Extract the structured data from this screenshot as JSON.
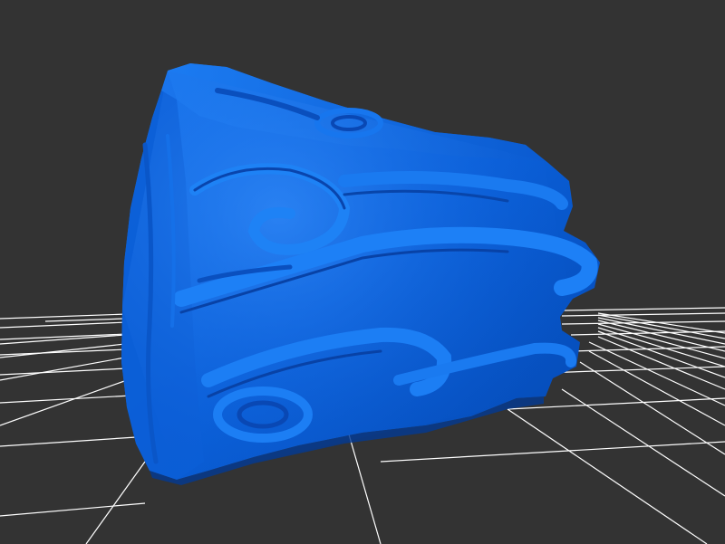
{
  "viewport": {
    "background_color": "#333333"
  },
  "grid": {
    "visible": true,
    "line_color": "#ffffff"
  },
  "model": {
    "color": "#0a5ad6",
    "shape": "carved stone block with relief ornament"
  }
}
